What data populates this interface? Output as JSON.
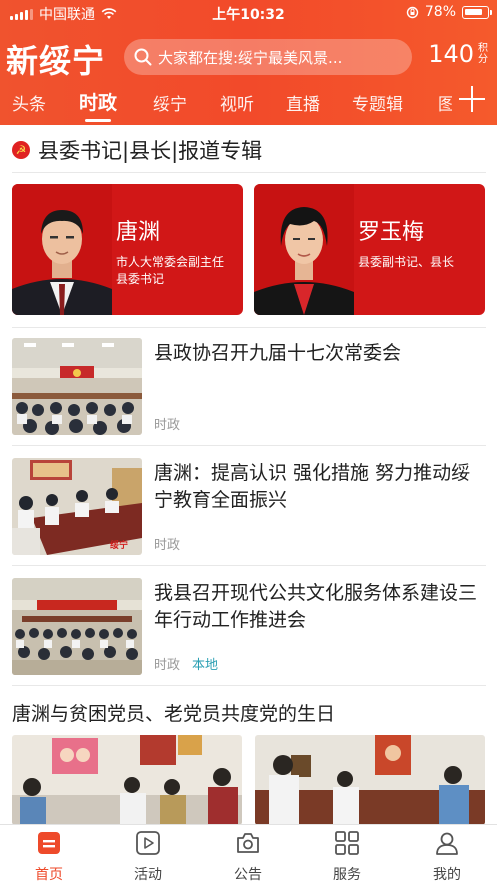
{
  "status_bar": {
    "carrier": "中国联通",
    "time": "上午10:32",
    "battery": "78%"
  },
  "header": {
    "logo": "新绥宁",
    "search_placeholder": "大家都在搜:绥宁最美风景...",
    "points_value": "140",
    "points_unit": "积分"
  },
  "tabs": [
    {
      "label": "头条"
    },
    {
      "label": "时政",
      "active": true
    },
    {
      "label": "绥宁"
    },
    {
      "label": "视听"
    },
    {
      "label": "直播"
    },
    {
      "label": "专题辑"
    },
    {
      "label": "图"
    }
  ],
  "section": {
    "title": "县委书记|县长|报道专辑"
  },
  "leaders": [
    {
      "name": "唐渊",
      "title": "市人大常委会副主任 县委书记"
    },
    {
      "name": "罗玉梅",
      "title": "县委副书记、县长"
    }
  ],
  "news": [
    {
      "headline": "县政协召开九届十七次常委会",
      "category": "时政",
      "tag": ""
    },
    {
      "headline": "唐渊：提高认识 强化措施 努力推动绥宁教育全面振兴",
      "category": "时政",
      "tag": "",
      "watermark": "绥宁"
    },
    {
      "headline": "我县召开现代公共文化服务体系建设三年行动工作推进会",
      "category": "时政",
      "tag": "本地"
    }
  ],
  "feature": {
    "headline": "唐渊与贫困党员、老党员共度党的生日"
  },
  "bottom_nav": [
    {
      "label": "首页",
      "icon": "home-icon",
      "active": true
    },
    {
      "label": "活动",
      "icon": "play-icon"
    },
    {
      "label": "公告",
      "icon": "camera-icon"
    },
    {
      "label": "服务",
      "icon": "grid-icon"
    },
    {
      "label": "我的",
      "icon": "user-icon"
    }
  ],
  "colors": {
    "brand": "#f04d2c",
    "card_red": "#d11717",
    "tag": "#2a9fb3"
  }
}
